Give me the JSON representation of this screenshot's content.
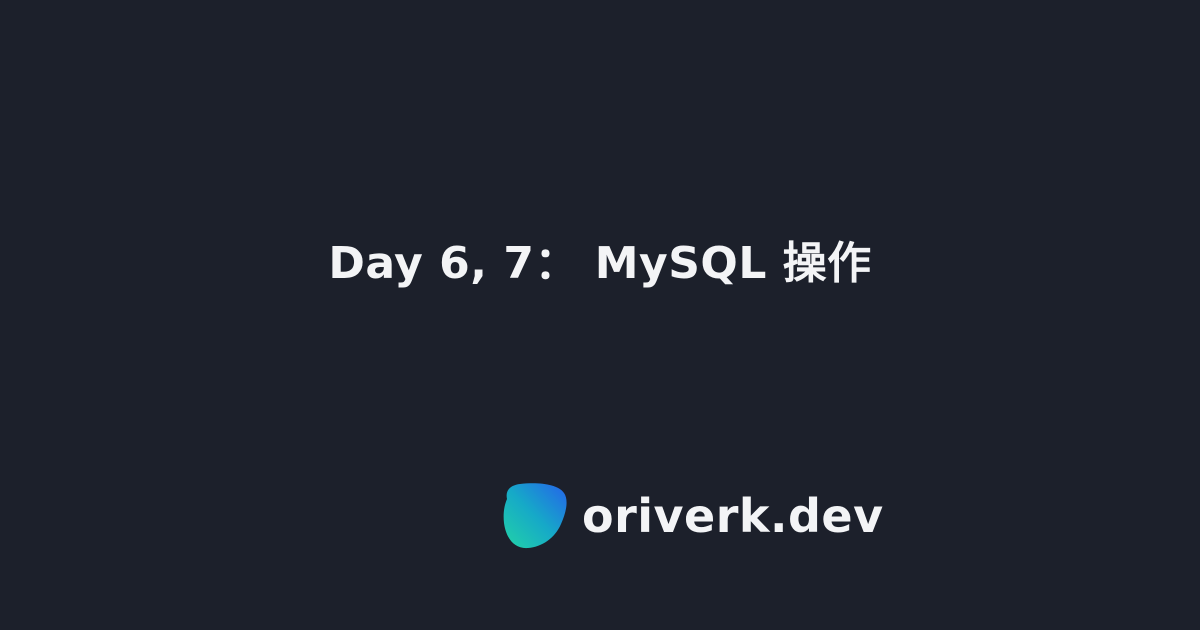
{
  "title": "Day 6, 7： MySQL 操作",
  "brand": {
    "name": "oriverk.dev",
    "logo_icon": "oriverk-logo-icon"
  },
  "colors": {
    "background": "#1c202b",
    "text": "#f3f4f6",
    "logo_gradient_start": "#22d3a6",
    "logo_gradient_mid": "#16a9c8",
    "logo_gradient_end": "#2563eb"
  }
}
